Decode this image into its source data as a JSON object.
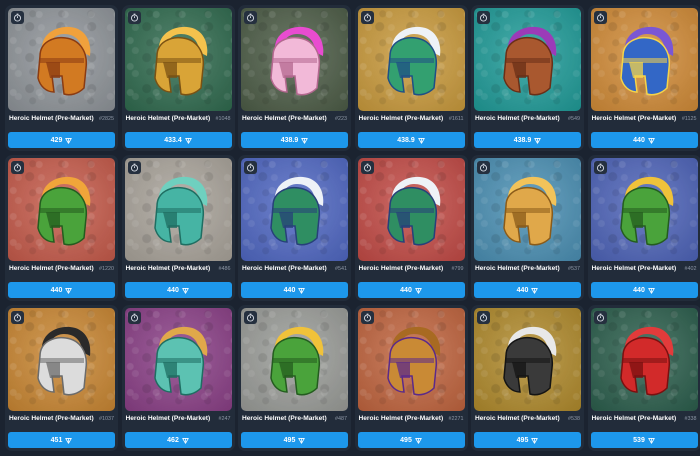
{
  "cards": [
    {
      "name": "Heroic Helmet (Pre-Market)",
      "number": "#2825",
      "price": "429",
      "bg": "#8f9499",
      "helmet": "#d27a22",
      "crest": "#f0a13c",
      "accent": "#8a3b12"
    },
    {
      "name": "Heroic Helmet (Pre-Market)",
      "number": "#1048",
      "price": "433.4",
      "bg": "#2f6a4e",
      "helmet": "#d9a437",
      "crest": "#f4c24d",
      "accent": "#7a5214"
    },
    {
      "name": "Heroic Helmet (Pre-Market)",
      "number": "#223",
      "price": "438.9",
      "bg": "#4c5c46",
      "helmet": "#f2b9d8",
      "crest": "#e84cd0",
      "accent": "#b3688f"
    },
    {
      "name": "Heroic Helmet (Pre-Market)",
      "number": "#1611",
      "price": "438.9",
      "bg": "#c99a3c",
      "helmet": "#33a070",
      "crest": "#eef2f7",
      "accent": "#1f4f86"
    },
    {
      "name": "Heroic Helmet (Pre-Market)",
      "number": "#549",
      "price": "438.9",
      "bg": "#1f9b98",
      "helmet": "#a9582f",
      "crest": "#9b3bb8",
      "accent": "#6a2f17"
    },
    {
      "name": "Heroic Helmet (Pre-Market)",
      "number": "#1125",
      "price": "440",
      "bg": "#d18b37",
      "helmet": "#3367c6",
      "crest": "#7a57d4",
      "accent": "#f5d44a"
    },
    {
      "name": "Heroic Helmet (Pre-Market)",
      "number": "#1220",
      "price": "440",
      "bg": "#c55a4a",
      "helmet": "#4aa33b",
      "crest": "#f0a53a",
      "accent": "#245c1f"
    },
    {
      "name": "Heroic Helmet (Pre-Market)",
      "number": "#486",
      "price": "440",
      "bg": "#a9a39a",
      "helmet": "#46b4a4",
      "crest": "#6fd0bf",
      "accent": "#1f6e62"
    },
    {
      "name": "Heroic Helmet (Pre-Market)",
      "number": "#541",
      "price": "440",
      "bg": "#4f67c2",
      "helmet": "#2f8e62",
      "crest": "#eef2f7",
      "accent": "#27407a"
    },
    {
      "name": "Heroic Helmet (Pre-Market)",
      "number": "#799",
      "price": "440",
      "bg": "#c24a45",
      "helmet": "#2f8e62",
      "crest": "#eef2f7",
      "accent": "#27407a"
    },
    {
      "name": "Heroic Helmet (Pre-Market)",
      "number": "#537",
      "price": "440",
      "bg": "#4a8fb3",
      "helmet": "#e0a84a",
      "crest": "#f2c35a",
      "accent": "#8a5b1a"
    },
    {
      "name": "Heroic Helmet (Pre-Market)",
      "number": "#402",
      "price": "440",
      "bg": "#4d63b8",
      "helmet": "#4aa33b",
      "crest": "#f0c23a",
      "accent": "#245c1f"
    },
    {
      "name": "Heroic Helmet (Pre-Market)",
      "number": "#1037",
      "price": "451",
      "bg": "#c98632",
      "helmet": "#dcdcdc",
      "crest": "#2a2a2a",
      "accent": "#6b6b6b"
    },
    {
      "name": "Heroic Helmet (Pre-Market)",
      "number": "#247",
      "price": "462",
      "bg": "#8a3f86",
      "helmet": "#5cc2b2",
      "crest": "#e0a84a",
      "accent": "#1f6e62"
    },
    {
      "name": "Heroic Helmet (Pre-Market)",
      "number": "#487",
      "price": "495",
      "bg": "#9a9c98",
      "helmet": "#4aa33b",
      "crest": "#f0c23a",
      "accent": "#245c1f"
    },
    {
      "name": "Heroic Helmet (Pre-Market)",
      "number": "#2271",
      "price": "495",
      "bg": "#c0643e",
      "helmet": "#c98a35",
      "crest": "#a86a22",
      "accent": "#5b2a8a"
    },
    {
      "name": "Heroic Helmet (Pre-Market)",
      "number": "#538",
      "price": "495",
      "bg": "#b08a2c",
      "helmet": "#3a3a3a",
      "crest": "#e8e8e8",
      "accent": "#141414"
    },
    {
      "name": "Heroic Helmet (Pre-Market)",
      "number": "#338",
      "price": "539",
      "bg": "#2b5e4c",
      "helmet": "#d22a2a",
      "crest": "#e23b3b",
      "accent": "#7a1010"
    }
  ],
  "icons": {
    "timer": "stopwatch-icon",
    "currency": "ton-diamond-icon"
  }
}
